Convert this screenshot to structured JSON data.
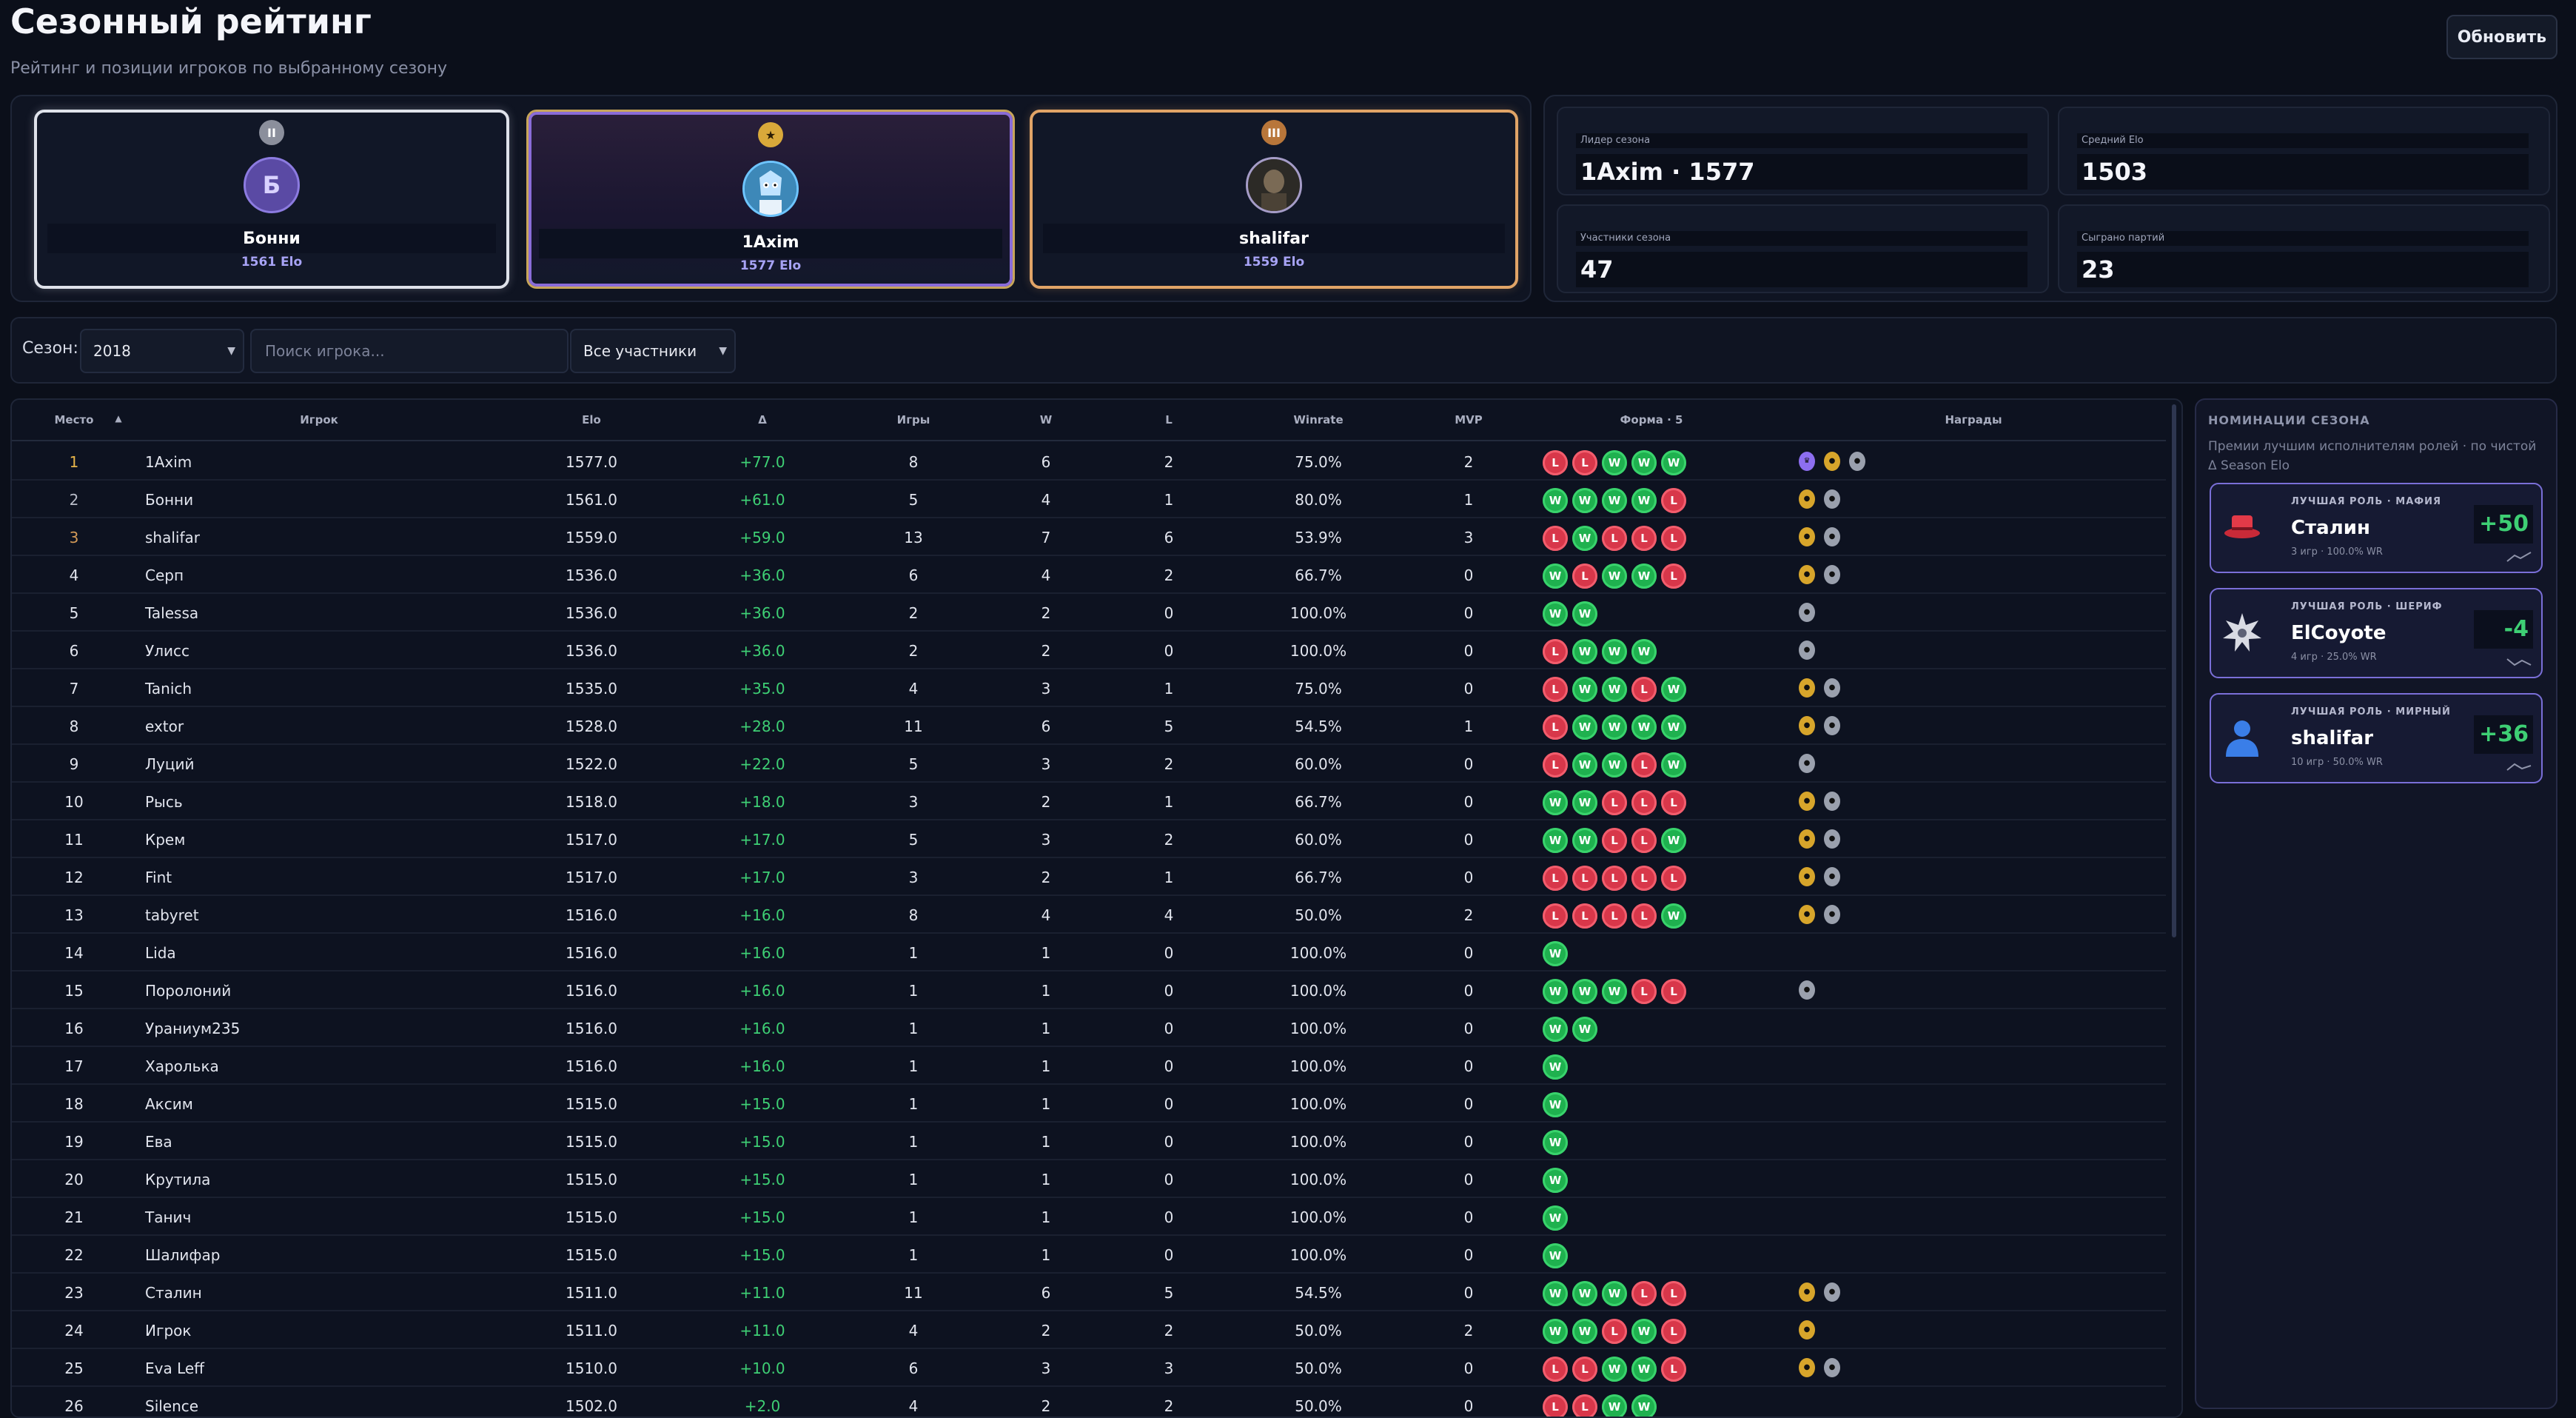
{
  "page": {
    "title": "Сезонный рейтинг",
    "subtitle": "Рейтинг и позиции игроков по выбранному сезону",
    "refresh_label": "Обновить"
  },
  "podium": [
    {
      "place": "2",
      "name": "Бонни",
      "initial": "Б",
      "elo": "1561 Elo",
      "medal": "II",
      "frame": "silver"
    },
    {
      "place": "1",
      "name": "1Axim",
      "initial": "",
      "elo": "1577 Elo",
      "medal": "★",
      "frame": "purple"
    },
    {
      "place": "3",
      "name": "shalifar",
      "initial": "",
      "elo": "1559 Elo",
      "medal": "III",
      "frame": "bronze"
    }
  ],
  "stats": [
    {
      "label": "Лидер сезона",
      "value": "1Axim · 1577"
    },
    {
      "label": "Средний Elo",
      "value": "1503"
    },
    {
      "label": "Участники сезона",
      "value": "47"
    },
    {
      "label": "Сыграно партий",
      "value": "23"
    }
  ],
  "filters": {
    "season_label": "Сезон:",
    "season_value": "2018",
    "search_placeholder": "Поиск игрока...",
    "participants_value": "Все участники"
  },
  "table": {
    "columns": [
      "Место",
      "Игрок",
      "Elo",
      "Δ",
      "Игры",
      "W",
      "L",
      "Winrate",
      "MVP",
      "Форма · 5",
      "Награды"
    ],
    "sort_icon": "▲",
    "rows": [
      {
        "place": "1",
        "player": "1Axim",
        "elo": "1577.0",
        "delta": "+77.0",
        "games": "8",
        "w": "6",
        "l": "2",
        "winrate": "75.0%",
        "mvp": "2",
        "form": [
          "L",
          "L",
          "W",
          "W",
          "W"
        ],
        "awards": [
          "p",
          "g",
          "s"
        ]
      },
      {
        "place": "2",
        "player": "Бонни",
        "elo": "1561.0",
        "delta": "+61.0",
        "games": "5",
        "w": "4",
        "l": "1",
        "winrate": "80.0%",
        "mvp": "1",
        "form": [
          "W",
          "W",
          "W",
          "W",
          "L"
        ],
        "awards": [
          "g",
          "s"
        ]
      },
      {
        "place": "3",
        "player": "shalifar",
        "elo": "1559.0",
        "delta": "+59.0",
        "games": "13",
        "w": "7",
        "l": "6",
        "winrate": "53.9%",
        "mvp": "3",
        "form": [
          "L",
          "W",
          "L",
          "L",
          "L"
        ],
        "awards": [
          "g",
          "s"
        ]
      },
      {
        "place": "4",
        "player": "Серп",
        "elo": "1536.0",
        "delta": "+36.0",
        "games": "6",
        "w": "4",
        "l": "2",
        "winrate": "66.7%",
        "mvp": "0",
        "form": [
          "W",
          "L",
          "W",
          "W",
          "L"
        ],
        "awards": [
          "g",
          "s"
        ]
      },
      {
        "place": "5",
        "player": "Talessa",
        "elo": "1536.0",
        "delta": "+36.0",
        "games": "2",
        "w": "2",
        "l": "0",
        "winrate": "100.0%",
        "mvp": "0",
        "form": [
          "W",
          "W"
        ],
        "awards": [
          "s"
        ]
      },
      {
        "place": "6",
        "player": "Улисс",
        "elo": "1536.0",
        "delta": "+36.0",
        "games": "2",
        "w": "2",
        "l": "0",
        "winrate": "100.0%",
        "mvp": "0",
        "form": [
          "L",
          "W",
          "W",
          "W"
        ],
        "awards": [
          "s"
        ]
      },
      {
        "place": "7",
        "player": "Tanich",
        "elo": "1535.0",
        "delta": "+35.0",
        "games": "4",
        "w": "3",
        "l": "1",
        "winrate": "75.0%",
        "mvp": "0",
        "form": [
          "L",
          "W",
          "W",
          "L",
          "W"
        ],
        "awards": [
          "g",
          "s"
        ]
      },
      {
        "place": "8",
        "player": "extor",
        "elo": "1528.0",
        "delta": "+28.0",
        "games": "11",
        "w": "6",
        "l": "5",
        "winrate": "54.5%",
        "mvp": "1",
        "form": [
          "L",
          "W",
          "W",
          "W",
          "W"
        ],
        "awards": [
          "g",
          "s"
        ]
      },
      {
        "place": "9",
        "player": "Луций",
        "elo": "1522.0",
        "delta": "+22.0",
        "games": "5",
        "w": "3",
        "l": "2",
        "winrate": "60.0%",
        "mvp": "0",
        "form": [
          "L",
          "W",
          "W",
          "L",
          "W"
        ],
        "awards": [
          "s"
        ]
      },
      {
        "place": "10",
        "player": "Рысь",
        "elo": "1518.0",
        "delta": "+18.0",
        "games": "3",
        "w": "2",
        "l": "1",
        "winrate": "66.7%",
        "mvp": "0",
        "form": [
          "W",
          "W",
          "L",
          "L",
          "L"
        ],
        "awards": [
          "g",
          "s"
        ]
      },
      {
        "place": "11",
        "player": "Крем",
        "elo": "1517.0",
        "delta": "+17.0",
        "games": "5",
        "w": "3",
        "l": "2",
        "winrate": "60.0%",
        "mvp": "0",
        "form": [
          "W",
          "W",
          "L",
          "L",
          "W"
        ],
        "awards": [
          "g",
          "s"
        ]
      },
      {
        "place": "12",
        "player": "Fint",
        "elo": "1517.0",
        "delta": "+17.0",
        "games": "3",
        "w": "2",
        "l": "1",
        "winrate": "66.7%",
        "mvp": "0",
        "form": [
          "L",
          "L",
          "L",
          "L",
          "L"
        ],
        "awards": [
          "g",
          "s"
        ]
      },
      {
        "place": "13",
        "player": "tabyret",
        "elo": "1516.0",
        "delta": "+16.0",
        "games": "8",
        "w": "4",
        "l": "4",
        "winrate": "50.0%",
        "mvp": "2",
        "form": [
          "L",
          "L",
          "L",
          "L",
          "W"
        ],
        "awards": [
          "g",
          "s"
        ]
      },
      {
        "place": "14",
        "player": "Lida",
        "elo": "1516.0",
        "delta": "+16.0",
        "games": "1",
        "w": "1",
        "l": "0",
        "winrate": "100.0%",
        "mvp": "0",
        "form": [
          "W"
        ],
        "awards": []
      },
      {
        "place": "15",
        "player": "Поролоний",
        "elo": "1516.0",
        "delta": "+16.0",
        "games": "1",
        "w": "1",
        "l": "0",
        "winrate": "100.0%",
        "mvp": "0",
        "form": [
          "W",
          "W",
          "W",
          "L",
          "L"
        ],
        "awards": [
          "s"
        ]
      },
      {
        "place": "16",
        "player": "Ураниум235",
        "elo": "1516.0",
        "delta": "+16.0",
        "games": "1",
        "w": "1",
        "l": "0",
        "winrate": "100.0%",
        "mvp": "0",
        "form": [
          "W",
          "W"
        ],
        "awards": []
      },
      {
        "place": "17",
        "player": "Харолька",
        "elo": "1516.0",
        "delta": "+16.0",
        "games": "1",
        "w": "1",
        "l": "0",
        "winrate": "100.0%",
        "mvp": "0",
        "form": [
          "W"
        ],
        "awards": []
      },
      {
        "place": "18",
        "player": "Аксим",
        "elo": "1515.0",
        "delta": "+15.0",
        "games": "1",
        "w": "1",
        "l": "0",
        "winrate": "100.0%",
        "mvp": "0",
        "form": [
          "W"
        ],
        "awards": []
      },
      {
        "place": "19",
        "player": "Ева",
        "elo": "1515.0",
        "delta": "+15.0",
        "games": "1",
        "w": "1",
        "l": "0",
        "winrate": "100.0%",
        "mvp": "0",
        "form": [
          "W"
        ],
        "awards": []
      },
      {
        "place": "20",
        "player": "Крутила",
        "elo": "1515.0",
        "delta": "+15.0",
        "games": "1",
        "w": "1",
        "l": "0",
        "winrate": "100.0%",
        "mvp": "0",
        "form": [
          "W"
        ],
        "awards": []
      },
      {
        "place": "21",
        "player": "Танич",
        "elo": "1515.0",
        "delta": "+15.0",
        "games": "1",
        "w": "1",
        "l": "0",
        "winrate": "100.0%",
        "mvp": "0",
        "form": [
          "W"
        ],
        "awards": []
      },
      {
        "place": "22",
        "player": "Шалифар",
        "elo": "1515.0",
        "delta": "+15.0",
        "games": "1",
        "w": "1",
        "l": "0",
        "winrate": "100.0%",
        "mvp": "0",
        "form": [
          "W"
        ],
        "awards": []
      },
      {
        "place": "23",
        "player": "Сталин",
        "elo": "1511.0",
        "delta": "+11.0",
        "games": "11",
        "w": "6",
        "l": "5",
        "winrate": "54.5%",
        "mvp": "0",
        "form": [
          "W",
          "W",
          "W",
          "L",
          "L"
        ],
        "awards": [
          "g",
          "s"
        ]
      },
      {
        "place": "24",
        "player": "Игрок",
        "elo": "1511.0",
        "delta": "+11.0",
        "games": "4",
        "w": "2",
        "l": "2",
        "winrate": "50.0%",
        "mvp": "2",
        "form": [
          "W",
          "W",
          "L",
          "W",
          "L"
        ],
        "awards": [
          "g"
        ]
      },
      {
        "place": "25",
        "player": "Eva Leff",
        "elo": "1510.0",
        "delta": "+10.0",
        "games": "6",
        "w": "3",
        "l": "3",
        "winrate": "50.0%",
        "mvp": "0",
        "form": [
          "L",
          "L",
          "W",
          "W",
          "L"
        ],
        "awards": [
          "g",
          "s"
        ]
      },
      {
        "place": "26",
        "player": "Silence",
        "elo": "1502.0",
        "delta": "+2.0",
        "games": "4",
        "w": "2",
        "l": "2",
        "winrate": "50.0%",
        "mvp": "0",
        "form": [
          "L",
          "L",
          "W",
          "W"
        ],
        "awards": []
      }
    ]
  },
  "nominations": {
    "title": "НОМИНАЦИИ СЕЗОНА",
    "description": "Премии лучшим исполнителям ролей · по чистой Δ Season Elo",
    "items": [
      {
        "role": "ЛУЧШАЯ РОЛЬ · МАФИЯ",
        "player": "Сталин",
        "sub": "3 игр · 100.0% WR",
        "delta": "+50",
        "icon": "hat-icon"
      },
      {
        "role": "ЛУЧШАЯ РОЛЬ · ШЕРИФ",
        "player": "ElCoyote",
        "sub": "4 игр · 25.0% WR",
        "delta": "-4",
        "icon": "sheriff-star-icon"
      },
      {
        "role": "ЛУЧШАЯ РОЛЬ · МИРНЫЙ",
        "player": "shalifar",
        "sub": "10 игр · 50.0% WR",
        "delta": "+36",
        "icon": "person-icon"
      }
    ]
  },
  "colors": {
    "win": "#1fb14f",
    "loss": "#d8374a",
    "accent": "#7a6fd8",
    "delta": "#3ecf74"
  }
}
